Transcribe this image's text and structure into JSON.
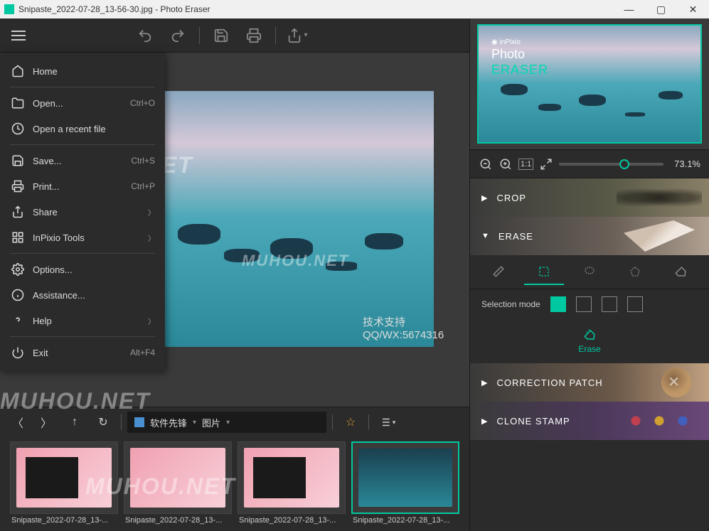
{
  "titlebar": {
    "title": "Snipaste_2022-07-28_13-56-30.jpg - Photo Eraser"
  },
  "menu": {
    "home": "Home",
    "open": "Open...",
    "open_shortcut": "Ctrl+O",
    "recent": "Open a recent file",
    "save": "Save...",
    "save_shortcut": "Ctrl+S",
    "print": "Print...",
    "print_shortcut": "Ctrl+P",
    "share": "Share",
    "tools": "InPixio Tools",
    "options": "Options...",
    "assistance": "Assistance...",
    "help": "Help",
    "exit": "Exit",
    "exit_shortcut": "Alt+F4"
  },
  "canvas": {
    "tech_support": "技术支持QQ/WX:5674316"
  },
  "filmstrip": {
    "breadcrumb1": "软件先锋",
    "breadcrumb2": "图片",
    "thumbs": [
      "Snipaste_2022-07-28_13-...",
      "Snipaste_2022-07-28_13-...",
      "Snipaste_2022-07-28_13-...",
      "Snipaste_2022-07-28_13-..."
    ]
  },
  "preview": {
    "brand_small": "◉ inPixio",
    "brand_line1": "Photo",
    "brand_line2": "ERASER"
  },
  "zoom": {
    "value": "73.1%"
  },
  "accordion": {
    "crop": "CROP",
    "erase": "ERASE",
    "correction": "CORRECTION PATCH",
    "clone": "CLONE STAMP"
  },
  "erase_panel": {
    "selection_mode": "Selection mode",
    "erase_action": "Erase"
  },
  "watermarks": {
    "w1": "MUHOU.NET",
    "w2": "MUHOU.NET",
    "w3": "MUHOU.NET",
    "w4": "MUHOU.NET"
  }
}
